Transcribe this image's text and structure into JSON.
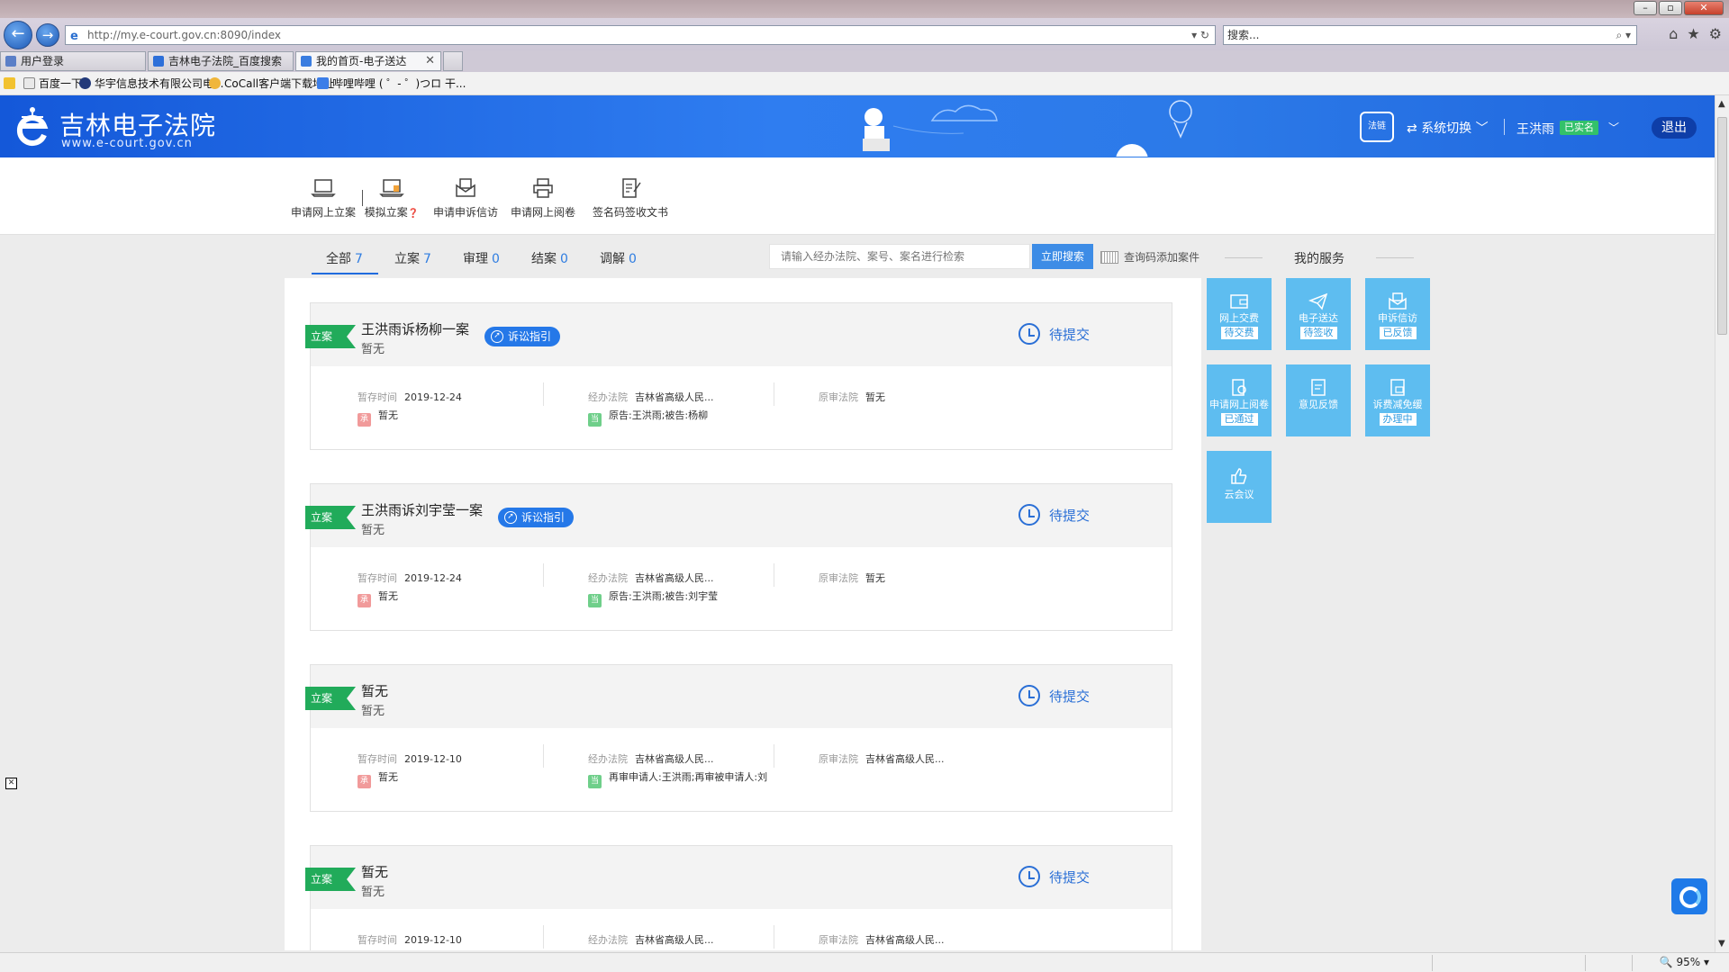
{
  "browser": {
    "url": "http://my.e-court.gov.cn:8090/index",
    "search_placeholder": "搜索...",
    "tabs": [
      {
        "label": "用户登录",
        "active": false
      },
      {
        "label": "吉林电子法院_百度搜索",
        "active": false
      },
      {
        "label": "我的首页-电子送达",
        "active": true
      }
    ],
    "favorites": [
      {
        "label": "百度一下"
      },
      {
        "label": "华宇信息技术有限公司电..."
      },
      {
        "label": "CoCall客户端下载地址"
      },
      {
        "label": "哔哩哔哩 ( ゜- ゜)つロ 干..."
      }
    ],
    "zoom": "95%"
  },
  "header": {
    "site_title": "吉林电子法院",
    "site_url": "www.e-court.gov.cn",
    "fa_logo": "法链",
    "system_switch": "系统切换",
    "username": "王洪雨",
    "verified_badge": "已实名",
    "logout": "退出"
  },
  "toolbar": [
    {
      "label": "申请网上立案",
      "icon": "laptop-icon"
    },
    {
      "label": "模拟立案",
      "icon": "laptop-file-icon"
    },
    {
      "label": "申请申诉信访",
      "icon": "envelope-doc-icon"
    },
    {
      "label": "申请网上阅卷",
      "icon": "printer-icon"
    },
    {
      "label": "签名码签收文书",
      "icon": "sign-doc-icon"
    }
  ],
  "filters": {
    "tabs": [
      {
        "label": "全部",
        "count": "7"
      },
      {
        "label": "立案",
        "count": "7"
      },
      {
        "label": "审理",
        "count": "0"
      },
      {
        "label": "结案",
        "count": "0"
      },
      {
        "label": "调解",
        "count": "0"
      }
    ],
    "search_placeholder": "请输入经办法院、案号、案名进行检索",
    "search_button": "立即搜索",
    "query_code": "查询码添加案件"
  },
  "services": {
    "title": "我的服务",
    "items": [
      {
        "label": "网上交费",
        "badge": "待交费"
      },
      {
        "label": "电子送达",
        "badge": "待签收"
      },
      {
        "label": "申诉信访",
        "badge": "已反馈"
      },
      {
        "label": "申请网上阅卷",
        "badge": "已通过"
      },
      {
        "label": "意见反馈",
        "badge": ""
      },
      {
        "label": "诉费减免缓",
        "badge": "办理中"
      },
      {
        "label": "云会议",
        "badge": ""
      }
    ]
  },
  "labels": {
    "saved_time": "暂存时间",
    "handling_court": "经办法院",
    "original_court": "原审法院",
    "guide": "诉讼指引",
    "icon_cheng": "承",
    "icon_dang": "当"
  },
  "cases": [
    {
      "tag": "立案",
      "title": "王洪雨诉杨柳一案",
      "subtitle": "暂无",
      "has_guide": true,
      "status": "待提交",
      "saved_time": "2019-12-24",
      "handler": "暂无",
      "handling_court": "吉林省高级人民...",
      "parties": "原告:王洪雨;被告:杨柳",
      "original_court": "暂无"
    },
    {
      "tag": "立案",
      "title": "王洪雨诉刘宇莹一案",
      "subtitle": "暂无",
      "has_guide": true,
      "status": "待提交",
      "saved_time": "2019-12-24",
      "handler": "暂无",
      "handling_court": "吉林省高级人民...",
      "parties": "原告:王洪雨;被告:刘宇莹",
      "original_court": "暂无"
    },
    {
      "tag": "立案",
      "title": "暂无",
      "subtitle": "暂无",
      "has_guide": false,
      "status": "待提交",
      "saved_time": "2019-12-10",
      "handler": "暂无",
      "handling_court": "吉林省高级人民...",
      "parties": "再审申请人:王洪雨;再审被申请人:刘",
      "original_court": "吉林省高级人民..."
    },
    {
      "tag": "立案",
      "title": "暂无",
      "subtitle": "暂无",
      "has_guide": false,
      "status": "待提交",
      "saved_time": "2019-12-10",
      "handler": "",
      "handling_court": "吉林省高级人民...",
      "parties": "",
      "original_court": "吉林省高级人民..."
    }
  ]
}
